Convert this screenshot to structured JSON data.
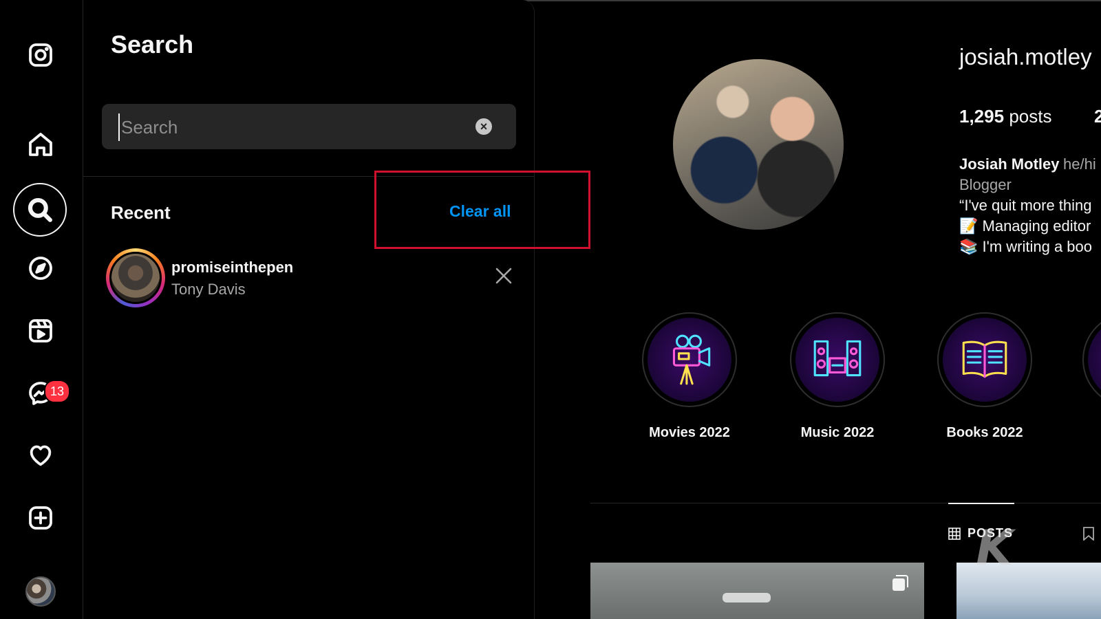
{
  "search_panel": {
    "title": "Search",
    "input_placeholder": "Search",
    "input_value": "",
    "recent_label": "Recent",
    "clear_all_label": "Clear all",
    "recent_items": [
      {
        "username": "promiseinthepen",
        "full_name": "Tony Davis"
      }
    ]
  },
  "sidebar": {
    "notification_badge": "13",
    "items": [
      {
        "name": "instagram-logo-icon"
      },
      {
        "name": "home-icon"
      },
      {
        "name": "search-icon",
        "active": true
      },
      {
        "name": "explore-compass-icon"
      },
      {
        "name": "reels-icon"
      },
      {
        "name": "messenger-icon"
      },
      {
        "name": "heart-icon"
      },
      {
        "name": "create-plus-icon"
      },
      {
        "name": "profile-avatar"
      }
    ]
  },
  "profile": {
    "username": "josiah.motley",
    "posts_count": "1,295",
    "posts_word": "posts",
    "stat2_partial": "2",
    "display_name": "Josiah Motley",
    "pronouns": "he/hi",
    "category": "Blogger",
    "bio_lines": [
      "“I've quit more thing",
      "📝 Managing editor",
      "📚 I'm writing a boo"
    ],
    "highlights": [
      {
        "label": "Movies 2022",
        "icon": "neon-movie-camera-icon"
      },
      {
        "label": "Music 2022",
        "icon": "neon-stereo-icon"
      },
      {
        "label": "Books 2022",
        "icon": "neon-book-icon"
      }
    ],
    "tabs": {
      "posts_label": "POSTS"
    }
  },
  "watermark": "K",
  "colors": {
    "accent_link": "#0095f6",
    "annotation_box": "#d0102c",
    "badge": "#ff3040",
    "background": "#000000"
  }
}
